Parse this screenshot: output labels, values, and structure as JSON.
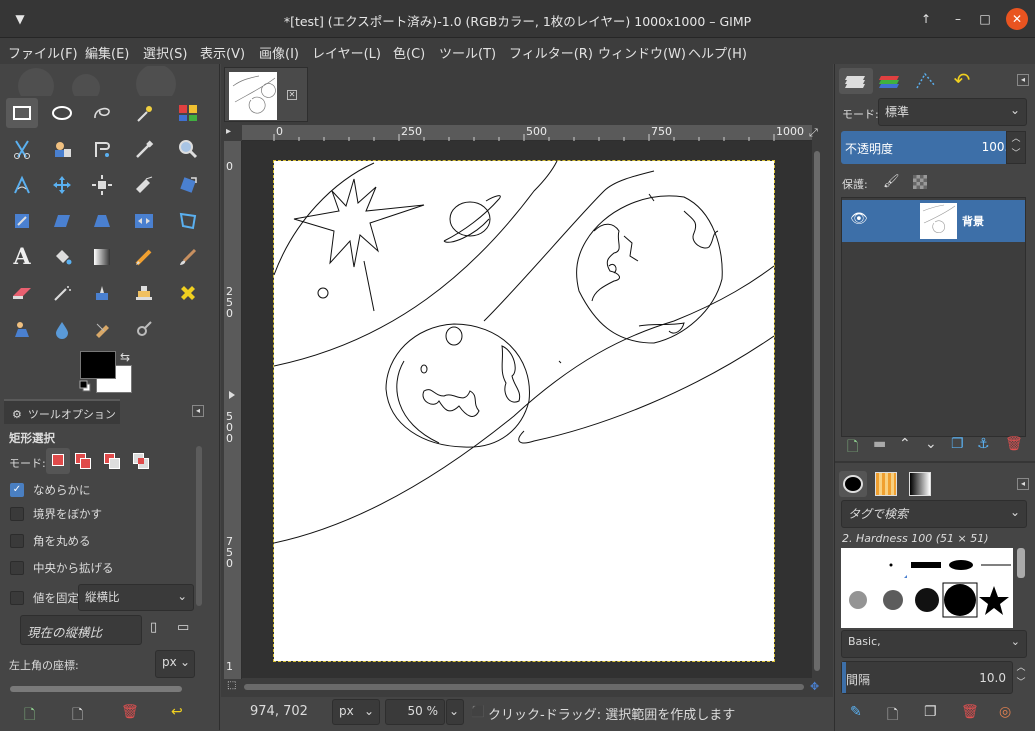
{
  "window": {
    "title": "*[test] (エクスポート済み)-1.0 (RGBカラー, 1枚のレイヤー) 1000x1000 – GIMP"
  },
  "menu": [
    "ファイル(F)",
    "編集(E)",
    "選択(S)",
    "表示(V)",
    "画像(I)",
    "レイヤー(L)",
    "色(C)",
    "ツール(T)",
    "フィルター(R)",
    "ウィンドウ(W)",
    "ヘルプ(H)"
  ],
  "tool_options": {
    "tab_label": "ツールオプション",
    "tool_name": "矩形選択",
    "mode_label": "モード:",
    "smooth_label": "なめらかに",
    "feather_label": "境界をぼかす",
    "round_label": "角を丸める",
    "expand_label": "中央から拡げる",
    "fixed_label": "値を固定",
    "fixed_value": "縦横比",
    "current_ratio": "現在の縦横比",
    "top_left_label": "左上角の座標:",
    "unit": "px"
  },
  "rulers": {
    "h_ticks": [
      "0",
      "250",
      "500",
      "750",
      "1000"
    ],
    "v_ticks": [
      "0",
      "2\n5\n0",
      "5\n0\n0",
      "7\n5\n0",
      "1"
    ]
  },
  "status": {
    "coords": "974, 702",
    "unit": "px",
    "zoom": "50 %",
    "message": "クリック-ドラッグ: 選択範囲を作成します"
  },
  "layers": {
    "mode_label": "モード:",
    "mode_value": "標準",
    "opacity_label": "不透明度",
    "opacity_value": "100.0",
    "lock_label": "保護:",
    "layer_name": "背景"
  },
  "brushes": {
    "tag_search": "タグで検索",
    "brush_name": "2. Hardness 100 (51 × 51)",
    "preset": "Basic,",
    "spacing_label": "間隔",
    "spacing_value": "10.0"
  },
  "colors": {
    "accent": "#3d6fa8",
    "close": "#e95420"
  }
}
